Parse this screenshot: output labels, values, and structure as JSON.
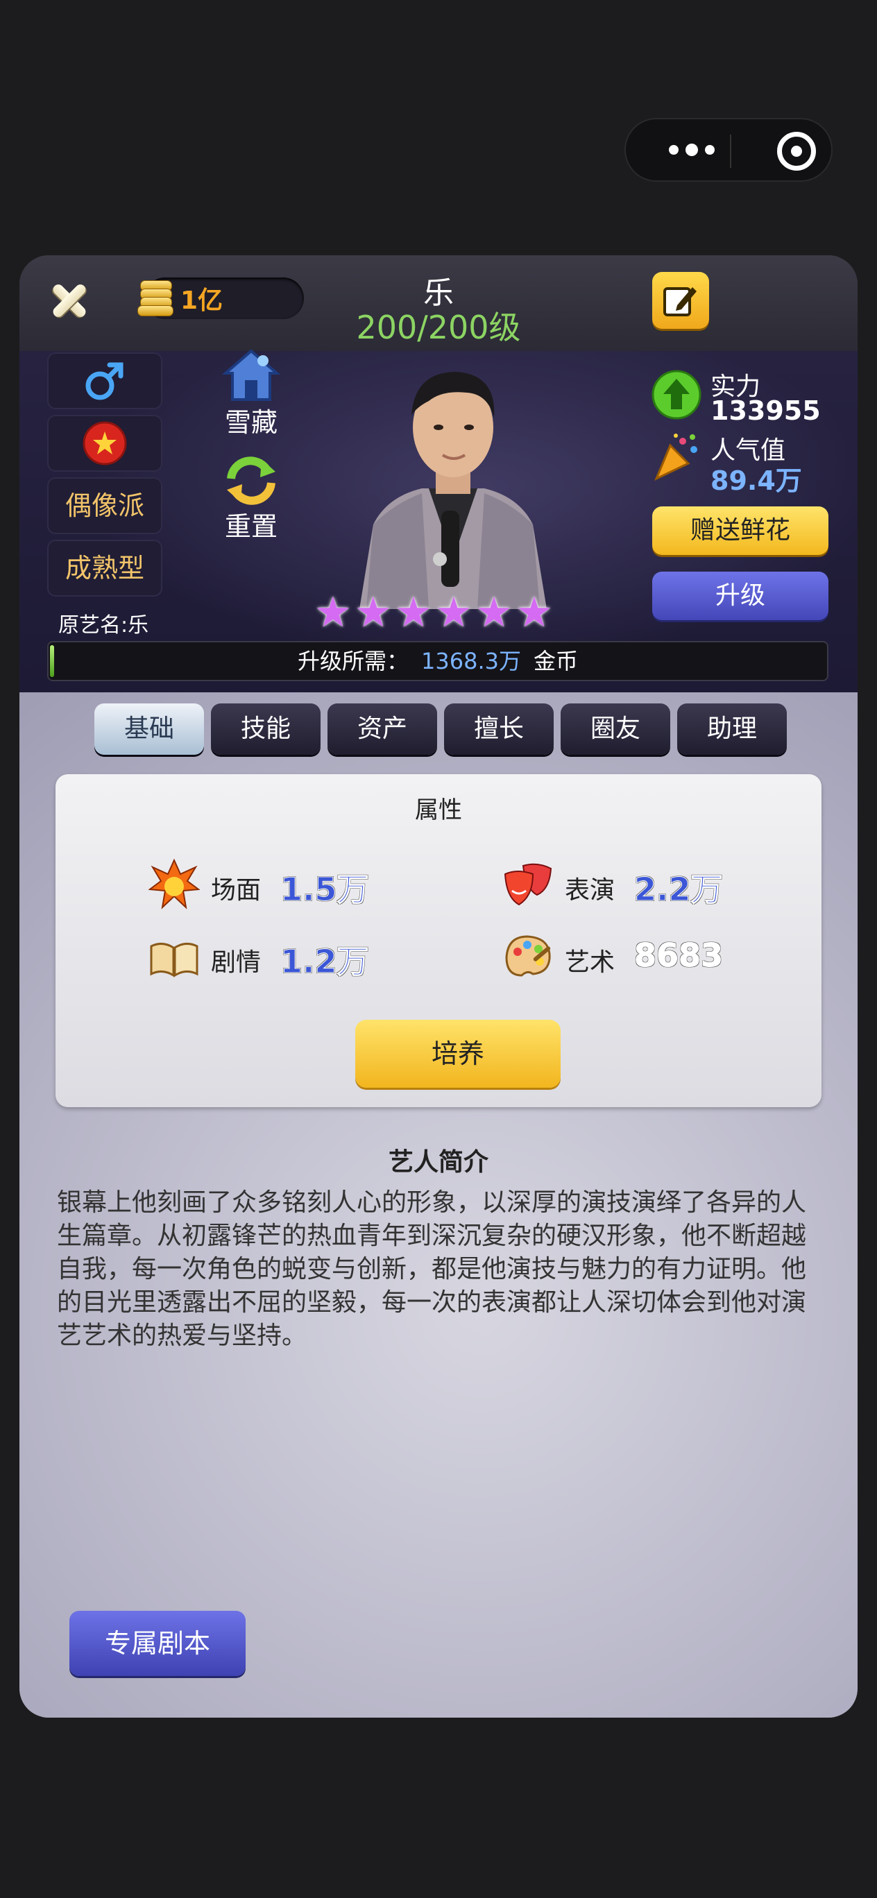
{
  "header": {
    "coins": "1亿",
    "name": "乐",
    "level": "200/200级"
  },
  "profile": {
    "tags": [
      "偶像派",
      "成熟型"
    ],
    "original_name": "原艺名:乐",
    "actions": {
      "collect": "雪藏",
      "reset": "重置"
    },
    "stars": 6,
    "strength_label": "实力",
    "strength_value": "133955",
    "popularity_label": "人气值",
    "popularity_value": "89.4万",
    "gift_button": "赠送鲜花",
    "upgrade_button": "升级"
  },
  "upgrade_cost": {
    "label": "升级所需：",
    "amount": "1368.3万",
    "unit": "金币",
    "progress": 0.005
  },
  "tabs": [
    {
      "label": "基础",
      "active": true
    },
    {
      "label": "技能",
      "active": false
    },
    {
      "label": "资产",
      "active": false
    },
    {
      "label": "擅长",
      "active": false
    },
    {
      "label": "圈友",
      "active": false
    },
    {
      "label": "助理",
      "active": false
    }
  ],
  "attributes": {
    "title": "属性",
    "items": [
      {
        "name": "场面",
        "value": "1.5万",
        "icon": "explosion-icon"
      },
      {
        "name": "表演",
        "value": "2.2万",
        "icon": "theater-masks-icon"
      },
      {
        "name": "剧情",
        "value": "1.2万",
        "icon": "book-icon"
      },
      {
        "name": "艺术",
        "value": "8683",
        "icon": "palette-icon"
      }
    ],
    "train_button": "培养"
  },
  "intro": {
    "title": "艺人简介",
    "text": "银幕上他刻画了众多铭刻人心的形象，以深厚的演技演绎了各异的人生篇章。从初露锋芒的热血青年到深沉复杂的硬汉形象，他不断超越自我，每一次角色的蜕变与创新，都是他演技与魅力的有力证明。他的目光里透露出不屈的坚毅，每一次的表演都让人深切体会到他对演艺艺术的热爱与坚持。"
  },
  "exclusive_script_button": "专属剧本",
  "colors": {
    "accent_gold": "#f3b81e",
    "accent_blue": "#4447b8",
    "star_purple": "#d46bf2",
    "level_green": "#8cd463"
  }
}
